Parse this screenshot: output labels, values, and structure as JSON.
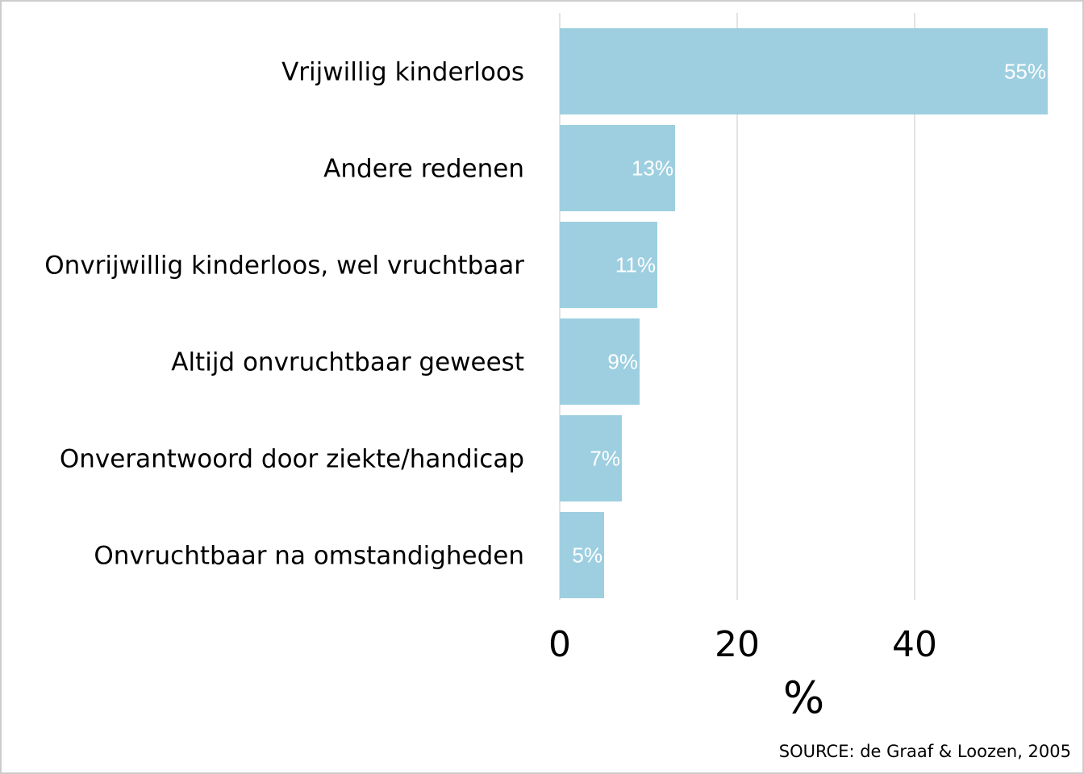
{
  "chart_data": {
    "type": "bar",
    "orientation": "horizontal",
    "categories": [
      "Vrijwillig kinderloos",
      "Andere redenen",
      "Onvrijwillig kinderloos, wel vruchtbaar",
      "Altijd onvruchtbaar geweest",
      "Onverantwoord door ziekte/handicap",
      "Onvruchtbaar na omstandigheden"
    ],
    "values": [
      55,
      13,
      11,
      9,
      7,
      5
    ],
    "value_labels": [
      "55%",
      "13%",
      "11%",
      "9%",
      "7%",
      "5%"
    ],
    "xlabel": "%",
    "ylabel": "",
    "xlim": [
      0,
      56
    ],
    "xticks": [
      0,
      20,
      40
    ],
    "grid": "vertical",
    "bar_color": "#9ecfe0",
    "grid_color": "#e3e3e3",
    "label_color": "#ffffff"
  },
  "source": "SOURCE: de Graaf & Loozen, 2005"
}
